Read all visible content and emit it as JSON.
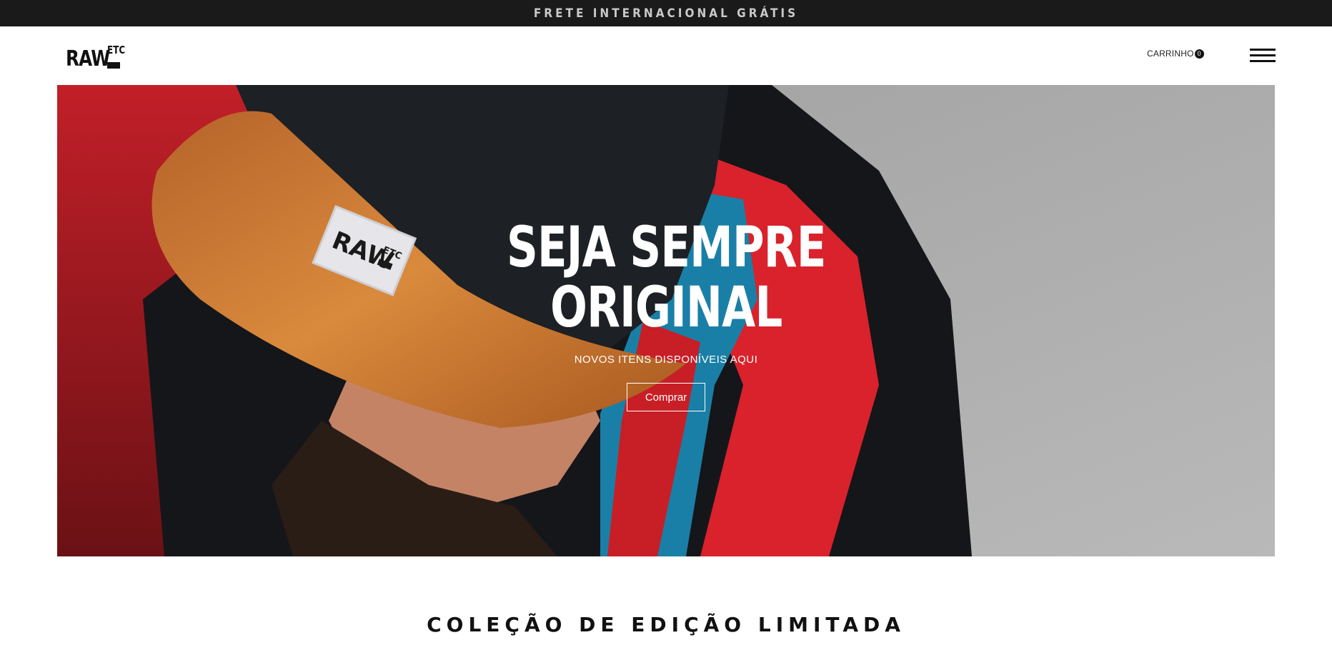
{
  "announcement": {
    "text": "FRETE INTERNACIONAL GRÁTIS"
  },
  "header": {
    "logo_main": "RAW",
    "logo_sup": "ETC",
    "cart_label": "CARRINHO",
    "cart_count": "0",
    "menu_icon": "hamburger-menu-icon"
  },
  "hero": {
    "title_line1": "SEJA SEMPRE",
    "title_line2": "ORIGINAL",
    "subtitle": "NOVOS ITENS DISPONÍVEIS AQUI",
    "button_label": "Comprar",
    "patch_main": "RAW",
    "patch_sup": "ETC"
  },
  "collection": {
    "title": "COLEÇÃO DE EDIÇÃO LIMITADA"
  },
  "colors": {
    "topbar_bg": "#1a1a1a",
    "topbar_text": "#c9c9c9",
    "cap_brim": "#c7732c",
    "cap_crown": "#1d2024",
    "jacket_red": "#d9222b",
    "jacket_blue": "#1a7fa6"
  }
}
